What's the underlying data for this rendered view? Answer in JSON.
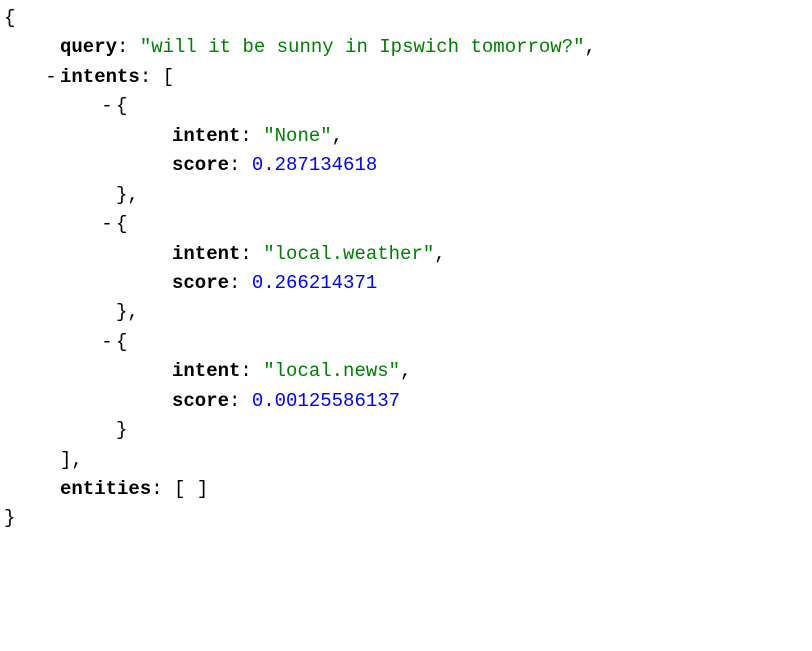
{
  "json": {
    "query_key": "query",
    "query_value": "\"will it be sunny in Ipswich tomorrow?\"",
    "intents_key": "intents",
    "intents": [
      {
        "intent_key": "intent",
        "intent_value": "\"None\"",
        "score_key": "score",
        "score_value": "0.287134618"
      },
      {
        "intent_key": "intent",
        "intent_value": "\"local.weather\"",
        "score_key": "score",
        "score_value": "0.266214371"
      },
      {
        "intent_key": "intent",
        "intent_value": "\"local.news\"",
        "score_key": "score",
        "score_value": "0.00125586137"
      }
    ],
    "entities_key": "entities",
    "entities_value": "[ ]",
    "toggle_symbol": "-",
    "open_brace": "{",
    "close_brace": "}",
    "open_bracket": "[",
    "close_bracket": "]",
    "colon": ": ",
    "comma": ","
  }
}
